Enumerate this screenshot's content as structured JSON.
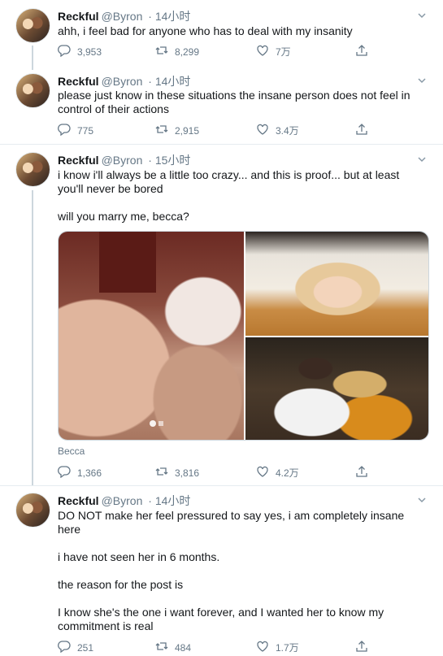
{
  "tweets": [
    {
      "name": "Reckful",
      "handle": "@Byron",
      "time": "· 14小时",
      "lines": [
        "ahh, i feel bad for anyone who has to deal with my insanity"
      ],
      "replies": "3,953",
      "retweets": "8,299",
      "likes": "7万"
    },
    {
      "name": "Reckful",
      "handle": "@Byron",
      "time": "· 14小时",
      "lines": [
        "please just know in these situations the insane person does not feel in",
        "control of their actions"
      ],
      "replies": "775",
      "retweets": "2,915",
      "likes": "3.4万"
    },
    {
      "name": "Reckful",
      "handle": "@Byron",
      "time": "· 15小时",
      "lines": [
        "i know i'll always be a little too crazy... and this is proof... but at least",
        "you'll never be bored",
        "",
        "will you marry me, becca?"
      ],
      "media_tag": "Becca",
      "replies": "1,366",
      "retweets": "3,816",
      "likes": "4.2万"
    },
    {
      "name": "Reckful",
      "handle": "@Byron",
      "time": "· 14小时",
      "lines": [
        "DO NOT make her feel pressured to say yes, i am completely insane",
        "here",
        "",
        "i have not seen her in 6 months.",
        "",
        "the reason for the post is",
        "",
        "I know she's the one i want forever, and I wanted her to know my",
        "commitment is real"
      ],
      "replies": "251",
      "retweets": "484",
      "likes": "1.7万"
    }
  ],
  "icons": {
    "reply": "reply-icon",
    "retweet": "retweet-icon",
    "like": "heart-icon",
    "share": "share-icon",
    "more": "chevron-down-icon"
  },
  "colors": {
    "text": "#14171a",
    "secondary": "#657786",
    "divider": "#e6ecf0",
    "thread_line": "#ccd6dd"
  }
}
